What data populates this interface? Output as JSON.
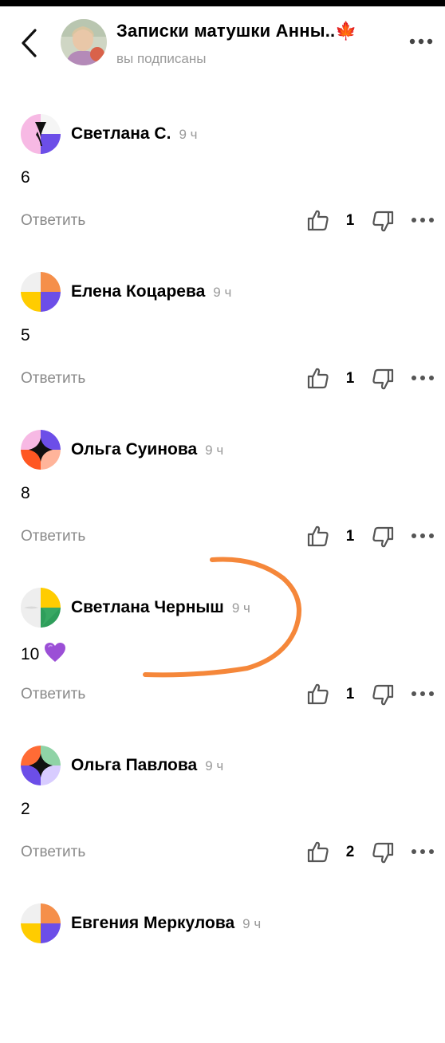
{
  "header": {
    "back_icon": "chevron-left-icon",
    "title": "Записки матушки Анны..🍁",
    "subtitle": "вы подписаны",
    "more_icon": "more-horizontal-icon"
  },
  "comments": [
    {
      "author": "Светлана С.",
      "time": "9 ч",
      "text": "6",
      "reply": "Ответить",
      "likes": "1"
    },
    {
      "author": "Елена Коцарева",
      "time": "9 ч",
      "text": "5",
      "reply": "Ответить",
      "likes": "1"
    },
    {
      "author": "Ольга Суинова",
      "time": "9 ч",
      "text": "8",
      "reply": "Ответить",
      "likes": "1"
    },
    {
      "author": "Светлана Черныш",
      "time": "9 ч",
      "text": "10",
      "emoji": "purple-heart",
      "reply": "Ответить",
      "likes": "1"
    },
    {
      "author": "Ольга Павлова",
      "time": "9 ч",
      "text": "2",
      "reply": "Ответить",
      "likes": "2"
    },
    {
      "author": "Евгения Меркулова",
      "time": "9 ч"
    }
  ],
  "colors": {
    "annotation": "#F5873A",
    "muted_text": "#9a9a9a",
    "emoji_heart": "#9B4FD6"
  }
}
